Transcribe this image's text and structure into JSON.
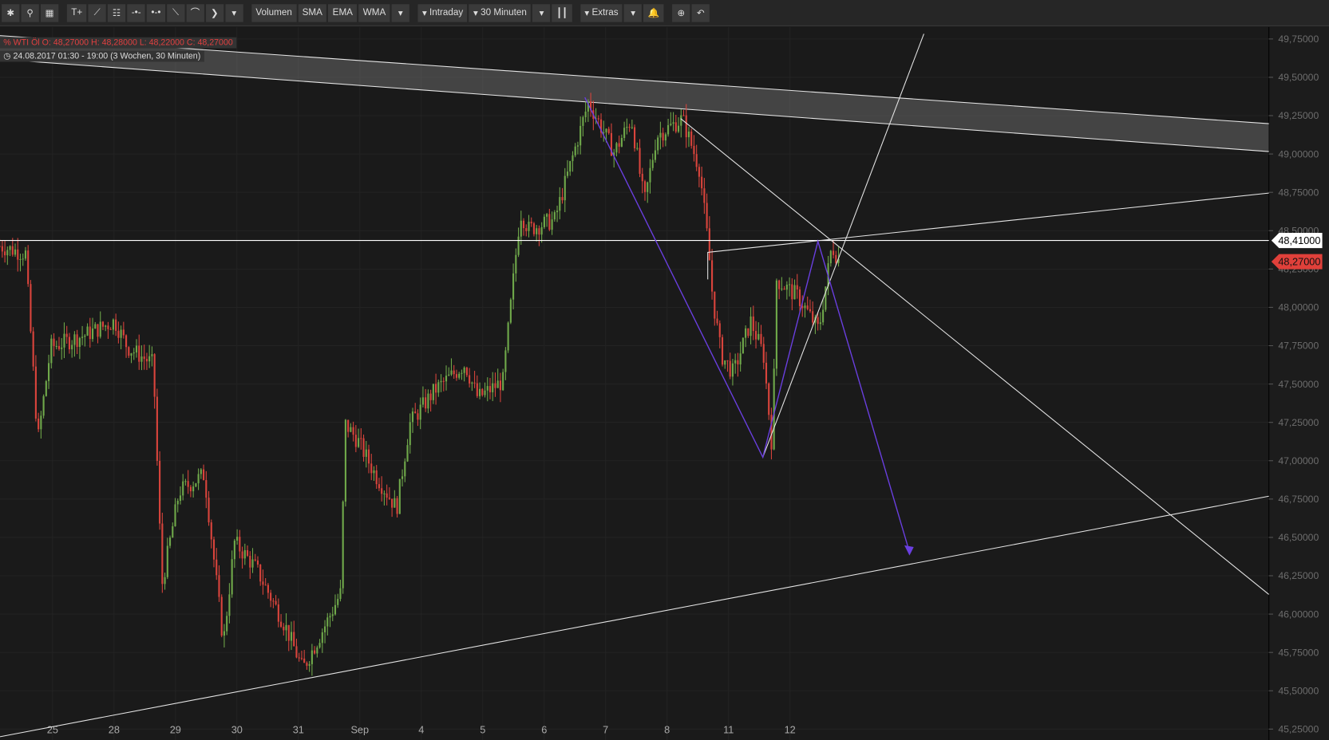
{
  "toolbar": {
    "icons": [
      "gear-icon",
      "search-icon",
      "grid-icon",
      "text-tool-icon",
      "line-tool-icon",
      "fibonacci-icon",
      "horizontal-line-icon",
      "segment-icon",
      "pen-icon",
      "arc-icon",
      "arrow-icon"
    ],
    "buttons": [
      "Volumen",
      "SMA",
      "EMA",
      "WMA"
    ],
    "intraday": "Intraday",
    "interval": "30 Minuten",
    "extras": "Extras",
    "more": "▾",
    "candle_glyph": "┃┃",
    "zoom_glyph": "⊕",
    "undo_glyph": "↶",
    "bell_glyph": "🔔"
  },
  "info": {
    "quote": "WTI Öl  O: 48,27000  H: 48,28000  L: 48,22000  C: 48,27000",
    "quote_icon": "%",
    "range": "24.08.2017 01:30 - 19:00  (3 Wochen, 30 Minuten)",
    "range_icon": "◷"
  },
  "colors": {
    "up": "#6fa84a",
    "down": "#d9443c",
    "line": "#e6e6e6",
    "pattern": "#6a3fe0",
    "last": "#e0403a"
  },
  "chart_data": {
    "type": "candlestick",
    "title": "WTI Öl",
    "x_unit": "trading days from 25 Aug",
    "xticks": [
      {
        "d": 0,
        "label": "25"
      },
      {
        "d": 1,
        "label": "28"
      },
      {
        "d": 2,
        "label": "29"
      },
      {
        "d": 3,
        "label": "30"
      },
      {
        "d": 4,
        "label": "31"
      },
      {
        "d": 5,
        "label": "Sep"
      },
      {
        "d": 6,
        "label": "4"
      },
      {
        "d": 7,
        "label": "5"
      },
      {
        "d": 8,
        "label": "6"
      },
      {
        "d": 9,
        "label": "7"
      },
      {
        "d": 10,
        "label": "8"
      },
      {
        "d": 11,
        "label": "11"
      },
      {
        "d": 12,
        "label": "12"
      }
    ],
    "yticks": [
      "49,75000",
      "49,50000",
      "49,25000",
      "49,00000",
      "48,75000",
      "48,50000",
      "48,25000",
      "48,00000",
      "47,75000",
      "47,50000",
      "47,25000",
      "47,00000",
      "46,75000",
      "46,50000",
      "46,25000",
      "46,00000",
      "45,75000",
      "45,50000",
      "45,25000"
    ],
    "ylim": [
      45.25,
      49.75
    ],
    "price_path": [
      [
        -0.86,
        48.4
      ],
      [
        -0.44,
        48.35
      ],
      [
        -0.24,
        47.13
      ],
      [
        -0.03,
        47.74
      ],
      [
        0.53,
        47.82
      ],
      [
        1.01,
        47.91
      ],
      [
        1.22,
        47.74
      ],
      [
        1.64,
        47.63
      ],
      [
        1.78,
        46.19
      ],
      [
        2.06,
        46.8
      ],
      [
        2.47,
        46.91
      ],
      [
        2.78,
        45.81
      ],
      [
        2.96,
        46.47
      ],
      [
        3.31,
        46.3
      ],
      [
        3.79,
        45.92
      ],
      [
        4.07,
        45.64
      ],
      [
        4.49,
        45.97
      ],
      [
        4.69,
        46.14
      ],
      [
        4.76,
        47.24
      ],
      [
        4.97,
        47.13
      ],
      [
        5.25,
        46.91
      ],
      [
        5.6,
        46.69
      ],
      [
        5.81,
        47.24
      ],
      [
        6.22,
        47.46
      ],
      [
        6.71,
        47.63
      ],
      [
        6.92,
        47.41
      ],
      [
        7.33,
        47.52
      ],
      [
        7.61,
        48.62
      ],
      [
        7.75,
        48.51
      ],
      [
        8.17,
        48.57
      ],
      [
        8.72,
        49.34
      ],
      [
        9.14,
        49.01
      ],
      [
        9.42,
        49.23
      ],
      [
        9.63,
        48.68
      ],
      [
        9.83,
        49.12
      ],
      [
        10.25,
        49.23
      ],
      [
        10.53,
        48.9
      ],
      [
        10.67,
        48.4
      ],
      [
        10.74,
        48.07
      ],
      [
        10.88,
        47.69
      ],
      [
        11.08,
        47.57
      ],
      [
        11.36,
        47.91
      ],
      [
        11.57,
        47.69
      ],
      [
        11.71,
        47.08
      ],
      [
        11.78,
        48.18
      ],
      [
        12.13,
        48.07
      ],
      [
        12.47,
        47.85
      ],
      [
        12.68,
        48.4
      ],
      [
        12.82,
        48.29
      ]
    ],
    "markers": {
      "horizontal_line": "48,41000",
      "last_price": "48,27000"
    }
  }
}
